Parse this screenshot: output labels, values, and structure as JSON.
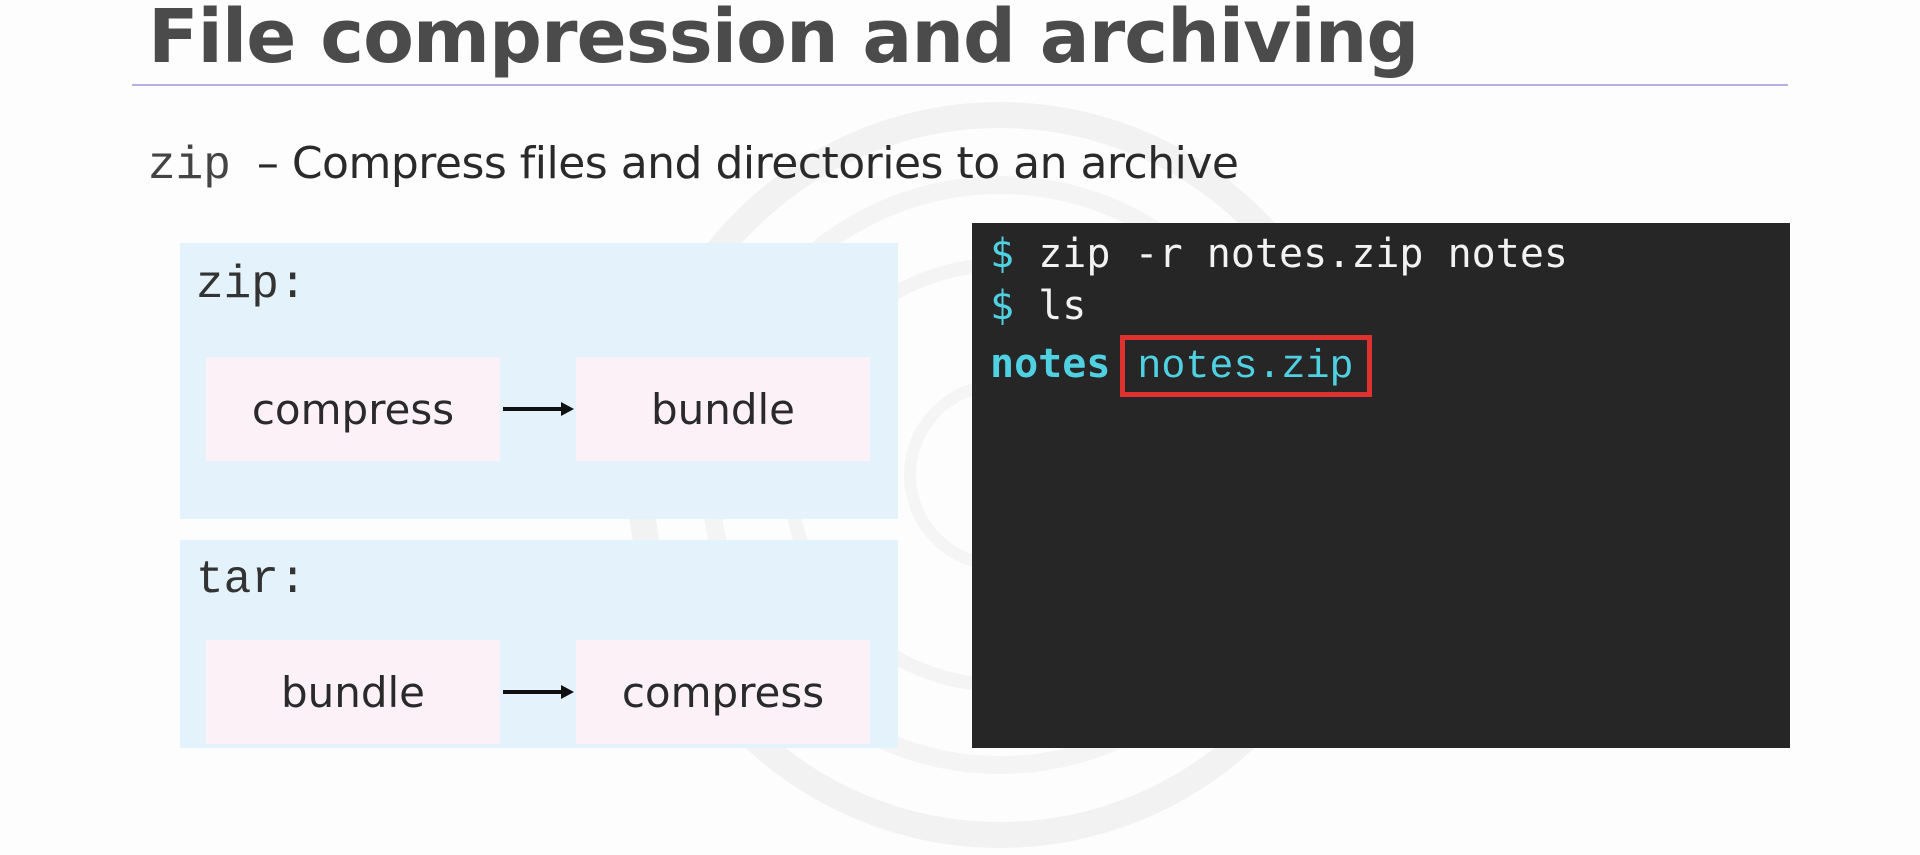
{
  "slide": {
    "title": "File compression and archiving",
    "subtitle": {
      "command": "zip",
      "description": "– Compress files and directories to an archive"
    }
  },
  "panels": {
    "zip": {
      "label": "zip:",
      "step1": "compress",
      "step2": "bundle"
    },
    "tar": {
      "label": "tar:",
      "step1": "bundle",
      "step2": "compress"
    }
  },
  "terminal": {
    "line1": {
      "prompt": "$",
      "command": "zip -r notes.zip notes"
    },
    "line2": {
      "prompt": "$",
      "command": "ls"
    },
    "line3": {
      "entry1": "notes",
      "entry2": "notes.zip"
    }
  },
  "colors": {
    "title": "#4b4b4b",
    "panel_background": "#e4f2fb",
    "step_background": "#fcf1f7",
    "terminal_background": "#262626",
    "terminal_accent": "#4fd1e2",
    "highlight": "#e03131"
  },
  "icons": {
    "arrow": "arrow-right-icon"
  }
}
